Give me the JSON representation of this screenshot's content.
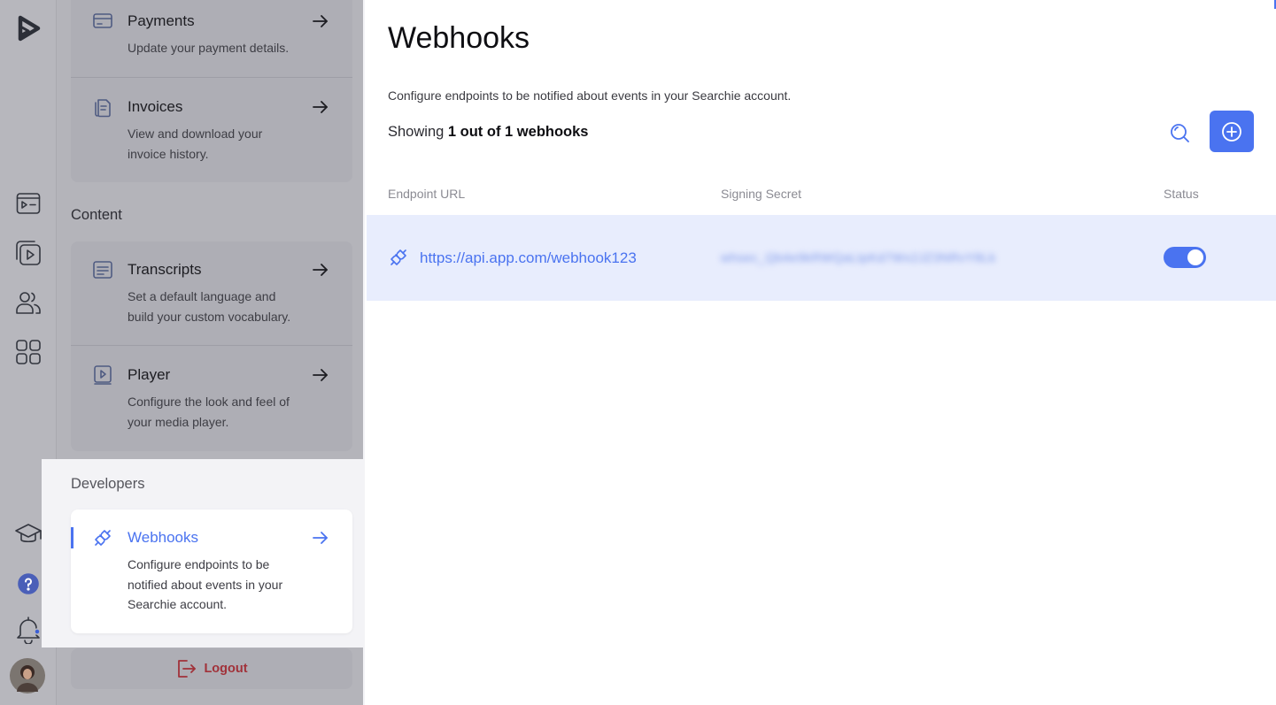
{
  "colors": {
    "accent": "#4a73f0",
    "danger": "#a1323a",
    "row_highlight": "#e8edfd"
  },
  "rail": {
    "icons": [
      "app-logo-icon",
      "video-list-icon",
      "media-library-icon",
      "users-icon",
      "dashboard-grid-icon",
      "graduation-cap-icon",
      "help-icon",
      "notification-bell-icon",
      "user-avatar"
    ]
  },
  "settings": {
    "billing_items": [
      {
        "title": "Payments",
        "desc": "Update your payment details.",
        "icon": "credit-card-icon"
      },
      {
        "title": "Invoices",
        "desc": "View and download your invoice history.",
        "icon": "invoice-icon"
      }
    ],
    "content_section": "Content",
    "content_items": [
      {
        "title": "Transcripts",
        "desc": "Set a default language and build your custom vocabulary.",
        "icon": "transcript-icon"
      },
      {
        "title": "Player",
        "desc": "Configure the look and feel of your media player.",
        "icon": "player-icon"
      }
    ],
    "developers_section": "Developers",
    "developer_items": [
      {
        "title": "Webhooks",
        "desc": "Configure endpoints to be notified about events in your Searchie account.",
        "icon": "plug-icon"
      }
    ],
    "logout_label": "Logout"
  },
  "main": {
    "title": "Webhooks",
    "subtitle": "Configure endpoints to be notified about events in your Searchie account.",
    "showing_prefix": "Showing",
    "showing_count": "1 out of 1 webhooks",
    "columns": [
      "Endpoint URL",
      "Signing Secret",
      "Status"
    ],
    "rows": [
      {
        "url": "https://api.app.com/webhook123",
        "secret": "whsec_Qb4e9kRWQaLtpKd7Wx2JZ3NRvY8Lk",
        "enabled": true
      }
    ]
  }
}
